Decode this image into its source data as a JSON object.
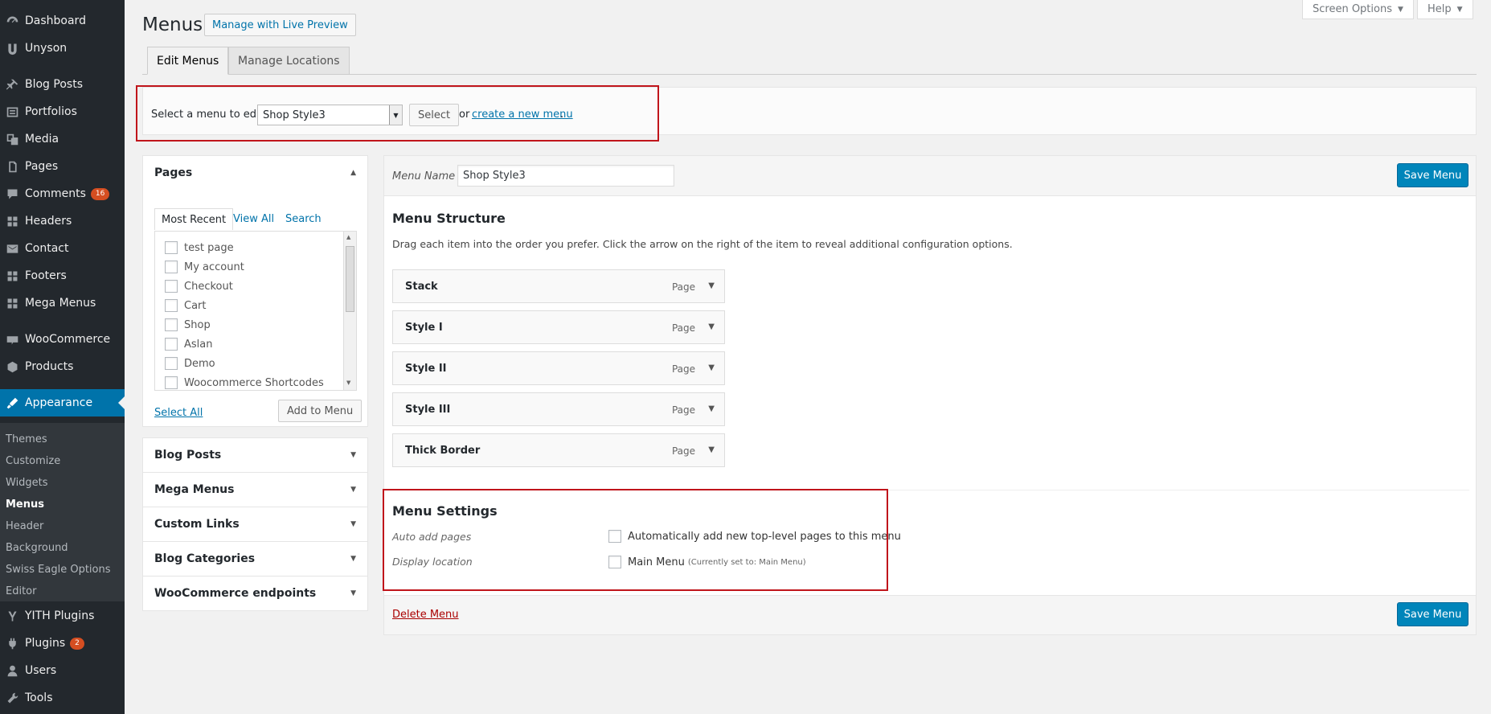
{
  "sidebar": {
    "items": [
      {
        "label": "Dashboard",
        "icon": "dashboard-icon"
      },
      {
        "label": "Unyson",
        "icon": "unyson-icon"
      },
      {
        "label": "Blog Posts",
        "icon": "pin-icon"
      },
      {
        "label": "Portfolios",
        "icon": "portfolio-icon"
      },
      {
        "label": "Media",
        "icon": "media-icon"
      },
      {
        "label": "Pages",
        "icon": "pages-icon"
      },
      {
        "label": "Comments",
        "icon": "comments-icon",
        "badge": "16"
      },
      {
        "label": "Headers",
        "icon": "grid-icon"
      },
      {
        "label": "Contact",
        "icon": "envelope-icon"
      },
      {
        "label": "Footers",
        "icon": "grid-icon"
      },
      {
        "label": "Mega Menus",
        "icon": "grid-icon"
      },
      {
        "label": "WooCommerce",
        "icon": "woocommerce-icon"
      },
      {
        "label": "Products",
        "icon": "products-icon"
      },
      {
        "label": "Appearance",
        "icon": "appearance-icon"
      },
      {
        "label": "YITH Plugins",
        "icon": "yith-icon"
      },
      {
        "label": "Plugins",
        "icon": "plugins-icon",
        "badge": "2"
      },
      {
        "label": "Users",
        "icon": "users-icon"
      },
      {
        "label": "Tools",
        "icon": "tools-icon"
      }
    ],
    "submenu": [
      "Themes",
      "Customize",
      "Widgets",
      "Menus",
      "Header",
      "Background",
      "Swiss Eagle Options",
      "Editor"
    ]
  },
  "topbar": {
    "screen_options": "Screen Options",
    "help": "Help"
  },
  "header": {
    "title": "Menus",
    "live_preview": "Manage with Live Preview"
  },
  "tabs": {
    "edit": "Edit Menus",
    "locations": "Manage Locations"
  },
  "select_bar": {
    "label": "Select a menu to edit:",
    "selected": "Shop Style3",
    "button": "Select",
    "or": "or",
    "create_link": "create a new menu",
    "dot": "."
  },
  "pages_box": {
    "title": "Pages",
    "tabs": {
      "recent": "Most Recent",
      "all": "View All",
      "search": "Search"
    },
    "items": [
      "test page",
      "My account",
      "Checkout",
      "Cart",
      "Shop",
      "Aslan",
      "Demo",
      "Woocommerce Shortcodes"
    ],
    "select_all": "Select All",
    "add_button": "Add to Menu"
  },
  "accordion": [
    "Blog Posts",
    "Mega Menus",
    "Custom Links",
    "Blog Categories",
    "WooCommerce endpoints"
  ],
  "menu_edit": {
    "name_label": "Menu Name",
    "name_value": "Shop Style3",
    "save": "Save Menu",
    "structure_title": "Menu Structure",
    "structure_desc": "Drag each item into the order you prefer. Click the arrow on the right of the item to reveal additional configuration options.",
    "items": [
      {
        "title": "Stack",
        "type": "Page"
      },
      {
        "title": "Style I",
        "type": "Page"
      },
      {
        "title": "Style II",
        "type": "Page"
      },
      {
        "title": "Style III",
        "type": "Page"
      },
      {
        "title": "Thick Border",
        "type": "Page"
      }
    ],
    "settings_title": "Menu Settings",
    "auto_add_label": "Auto add pages",
    "auto_add_text": "Automatically add new top-level pages to this menu",
    "display_label": "Display location",
    "display_text": "Main Menu",
    "display_note": "(Currently set to: Main Menu)",
    "delete": "Delete Menu"
  },
  "colors": {
    "accent": "#0073aa",
    "save_button": "#0085ba",
    "highlight_box": "#c0151b",
    "sidebar_bg": "#23282d"
  }
}
